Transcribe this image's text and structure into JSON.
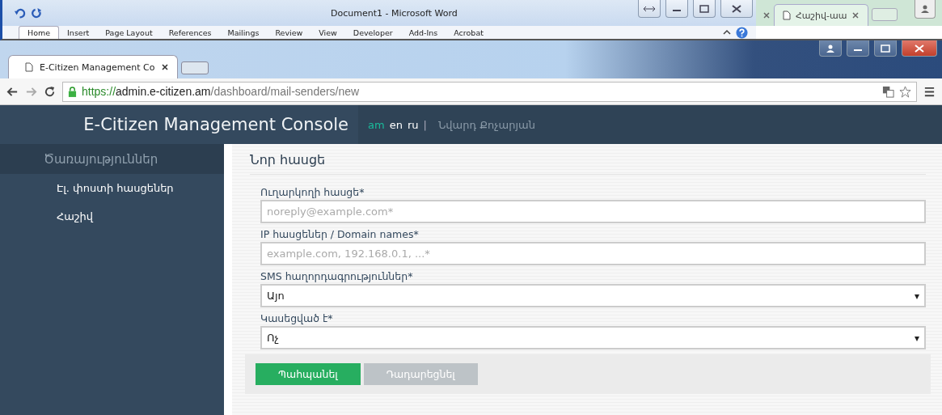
{
  "word_window": {
    "title": "Document1  -  Microsoft Word",
    "ribbon_tabs": [
      {
        "label": "Home",
        "selected": true
      },
      {
        "label": "Insert",
        "selected": false
      },
      {
        "label": "Page Layout",
        "selected": false
      },
      {
        "label": "References",
        "selected": false
      },
      {
        "label": "Mailings",
        "selected": false
      },
      {
        "label": "Review",
        "selected": false
      },
      {
        "label": "View",
        "selected": false
      },
      {
        "label": "Developer",
        "selected": false
      },
      {
        "label": "Add-Ins",
        "selected": false
      },
      {
        "label": "Acrobat",
        "selected": false
      }
    ]
  },
  "back_browser": {
    "tab": "Հաշիվ-աա"
  },
  "browser": {
    "tab": "E-Citizen Management Co",
    "url": {
      "scheme": "https://",
      "host": "admin.e-citizen.am",
      "path": "/dashboard/mail-senders/new"
    }
  },
  "header": {
    "title": "E-Citizen Management Console",
    "languages": [
      {
        "label": "am",
        "selected": true
      },
      {
        "label": "en",
        "selected": false
      },
      {
        "label": "ru",
        "selected": false
      }
    ],
    "separator": "|",
    "user": "Նվարդ Քոչարյան"
  },
  "sidebar": {
    "heading": "Ծառայություններ",
    "items": [
      "Էլ. փոստի հասցեներ",
      "Հաշիվ"
    ]
  },
  "form": {
    "title": "Նոր հասցե",
    "fields": [
      {
        "kind": "input",
        "label": "Ուղարկողի հասցե*",
        "placeholder": "noreply@example.com*"
      },
      {
        "kind": "input",
        "label": "IP հասցեներ / Domain names*",
        "placeholder": "example.com, 192.168.0.1, ...*"
      },
      {
        "kind": "select",
        "label": "SMS հաղորդագրություններ*",
        "value": "Այո",
        "arrow": "▾"
      },
      {
        "kind": "select",
        "label": "Կասեցված է*",
        "value": "Ոչ",
        "arrow": "▾"
      }
    ],
    "buttons": [
      {
        "kind": "primary",
        "label": "Պահպանել"
      },
      {
        "kind": "secondary",
        "label": "Դադարեցնել"
      }
    ]
  }
}
